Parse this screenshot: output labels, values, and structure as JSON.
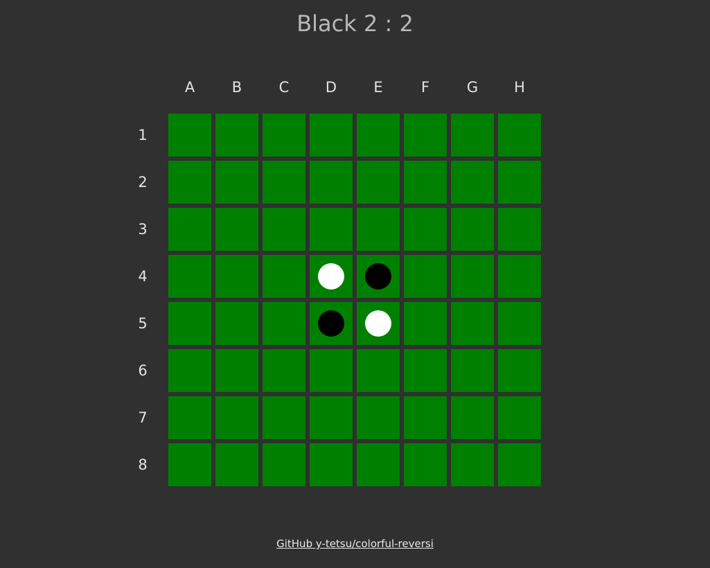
{
  "status": {
    "turn": "Black",
    "black_score": "2",
    "white_score": "2",
    "text": "Black 2 : 2"
  },
  "board": {
    "columns": [
      "A",
      "B",
      "C",
      "D",
      "E",
      "F",
      "G",
      "H"
    ],
    "rows": [
      "1",
      "2",
      "3",
      "4",
      "5",
      "6",
      "7",
      "8"
    ],
    "cell_color": "#008000",
    "pieces": [
      {
        "cell": "D4",
        "color": "white"
      },
      {
        "cell": "E4",
        "color": "black"
      },
      {
        "cell": "D5",
        "color": "black"
      },
      {
        "cell": "E5",
        "color": "white"
      }
    ],
    "piece_colors": {
      "white": "#ffffff",
      "black": "#000000"
    }
  },
  "footer": {
    "link_text": "GitHub y-tetsu/colorful-reversi"
  }
}
